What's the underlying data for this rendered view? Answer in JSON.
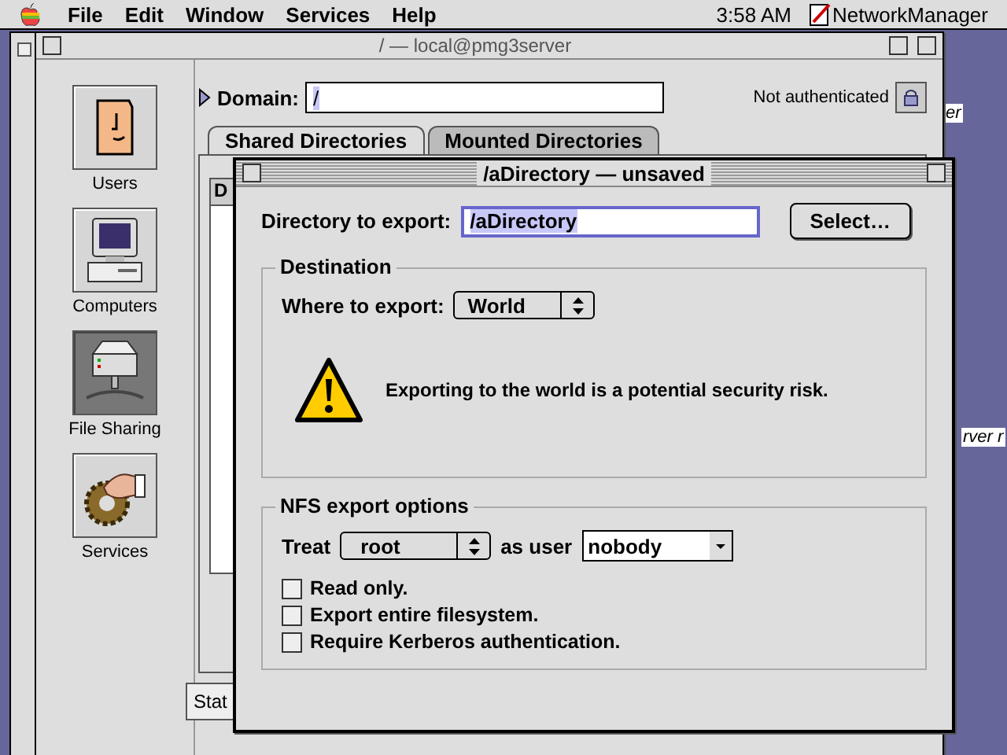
{
  "menu_bar": {
    "menus": [
      "File",
      "Edit",
      "Window",
      "Services",
      "Help"
    ],
    "clock": "3:58 AM",
    "app": "NetworkManager"
  },
  "desktop": {
    "labels": [
      "er",
      "rver r"
    ]
  },
  "main_window": {
    "title": "/ — local@pmg3server",
    "sidebar": [
      {
        "kind": "users",
        "label": "Users",
        "selected": false
      },
      {
        "kind": "computers",
        "label": "Computers",
        "selected": false
      },
      {
        "kind": "sharing",
        "label": "File Sharing",
        "selected": true
      },
      {
        "kind": "services",
        "label": "Services",
        "selected": false
      }
    ],
    "domain_label": "Domain:",
    "domain_value": "/",
    "auth_status": "Not authenticated",
    "tabs": [
      {
        "label": "Shared Directories",
        "selected": true
      },
      {
        "label": "Mounted Directories",
        "selected": false
      }
    ],
    "list_column": "D",
    "status": "Stat"
  },
  "dialog": {
    "title": "/aDirectory — unsaved",
    "directory_label": "Directory to export:",
    "directory_value": "/aDirectory",
    "select_button": "Select…",
    "destination": {
      "title": "Destination",
      "where_label": "Where to export:",
      "where_value": "World",
      "warning": "Exporting to the world is a potential security risk."
    },
    "nfs": {
      "title": "NFS export options",
      "treat_label": "Treat",
      "treat_value": "root",
      "as_user_label": "as user",
      "as_user_value": "nobody",
      "options": [
        {
          "label": "Read only.",
          "checked": false
        },
        {
          "label": "Export entire filesystem.",
          "checked": false
        },
        {
          "label": "Require Kerberos authentication.",
          "checked": false
        }
      ]
    }
  }
}
